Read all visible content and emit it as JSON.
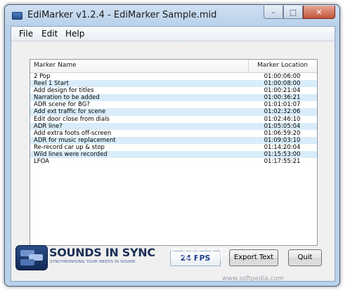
{
  "window": {
    "title": "EdiMarker v1.2.4 - EdiMarker Sample.mid",
    "controls": {
      "minimize": "–",
      "maximize": "□",
      "close": "✕"
    }
  },
  "menu": [
    "File",
    "Edit",
    "Help"
  ],
  "table": {
    "columns": {
      "name": "Marker Name",
      "location": "Marker Location"
    },
    "rows": [
      {
        "name": "2 Pop",
        "location": "01:00:06:00"
      },
      {
        "name": "Reel 1 Start",
        "location": "01:00:08:00"
      },
      {
        "name": "Add design for titles",
        "location": "01:00:21:04"
      },
      {
        "name": "Narration to be added",
        "location": "01:00:36:21"
      },
      {
        "name": "ADR scene for BG?",
        "location": "01:01:01:07"
      },
      {
        "name": "Add ext traffic for scene",
        "location": "01:02:32:06"
      },
      {
        "name": "Edit door close from dials",
        "location": "01:02:46:10"
      },
      {
        "name": "ADR line?",
        "location": "01:05:05:04"
      },
      {
        "name": "Add extra foots off-screen",
        "location": "01:06:59:20"
      },
      {
        "name": "ADR for music replacement",
        "location": "01:09:03:10"
      },
      {
        "name": "Re-record car up & stop",
        "location": "01:14:20:04"
      },
      {
        "name": "Wild lines were recorded",
        "location": "01:15:53:00"
      },
      {
        "name": "LFOA",
        "location": "01:17:55:21"
      }
    ]
  },
  "logo": {
    "name": "SOUNDS IN SYNC",
    "tagline": "SYNCHRONISING YOUR NEEDS IN SOUND"
  },
  "fps": "24 FPS",
  "buttons": {
    "export": "Export Text",
    "quit": "Quit"
  },
  "watermark": {
    "text": "SOFTPEDIA",
    "url": "www.softpedia.com"
  },
  "colors": {
    "row_alt": "#d9ecf9",
    "fps_text": "#1f3d8a",
    "frame": "#b9d1ea"
  }
}
